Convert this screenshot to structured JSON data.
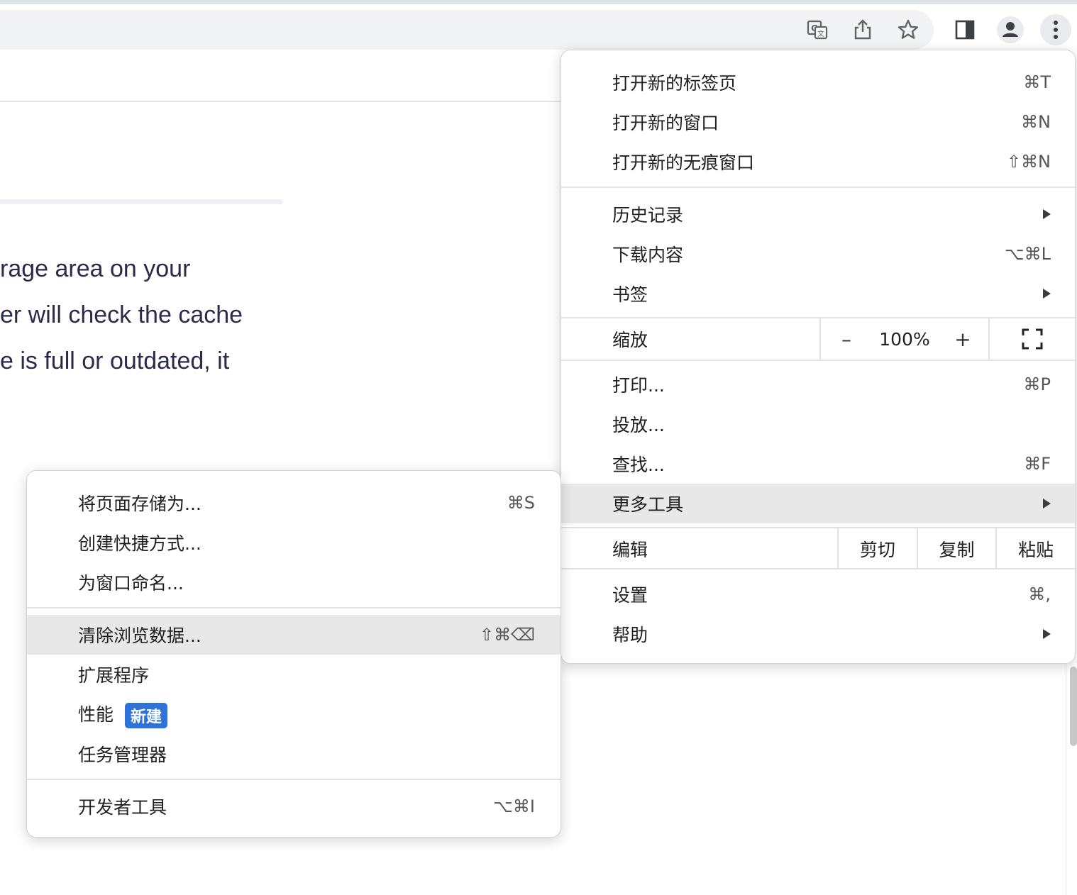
{
  "page": {
    "paragraph_lines": [
      "rage area on your",
      "er will check the cache",
      "e is full or outdated, it"
    ]
  },
  "toolbar": {
    "icons": [
      "translate-icon",
      "share-icon",
      "bookmark-star-icon",
      "side-panel-icon",
      "profile-icon",
      "more-menu-icon"
    ]
  },
  "main_menu": {
    "new_tab": {
      "label": "打开新的标签页",
      "shortcut": "⌘T"
    },
    "new_window": {
      "label": "打开新的窗口",
      "shortcut": "⌘N"
    },
    "new_incognito": {
      "label": "打开新的无痕窗口",
      "shortcut": "⇧⌘N"
    },
    "history": {
      "label": "历史记录"
    },
    "downloads": {
      "label": "下载内容",
      "shortcut": "⌥⌘L"
    },
    "bookmarks": {
      "label": "书签"
    },
    "zoom": {
      "label": "缩放",
      "minus": "–",
      "value": "100%",
      "plus": "+"
    },
    "print": {
      "label": "打印...",
      "shortcut": "⌘P"
    },
    "cast": {
      "label": "投放..."
    },
    "find": {
      "label": "查找...",
      "shortcut": "⌘F"
    },
    "more_tools": {
      "label": "更多工具"
    },
    "edit": {
      "label": "编辑",
      "cut": "剪切",
      "copy": "复制",
      "paste": "粘贴"
    },
    "settings": {
      "label": "设置",
      "shortcut": "⌘,"
    },
    "help": {
      "label": "帮助"
    }
  },
  "sub_menu": {
    "save_page": {
      "label": "将页面存储为...",
      "shortcut": "⌘S"
    },
    "create_shortcut": {
      "label": "创建快捷方式..."
    },
    "name_window": {
      "label": "为窗口命名..."
    },
    "clear_data": {
      "label": "清除浏览数据...",
      "shortcut": "⇧⌘⌫"
    },
    "extensions": {
      "label": "扩展程序"
    },
    "performance": {
      "label": "性能",
      "badge": "新建"
    },
    "task_manager": {
      "label": "任务管理器"
    },
    "dev_tools": {
      "label": "开发者工具",
      "shortcut": "⌥⌘I"
    }
  },
  "colors": {
    "highlight": "#e8e8e8",
    "badge": "#2f72d8",
    "page_text": "#2a2b4a"
  }
}
